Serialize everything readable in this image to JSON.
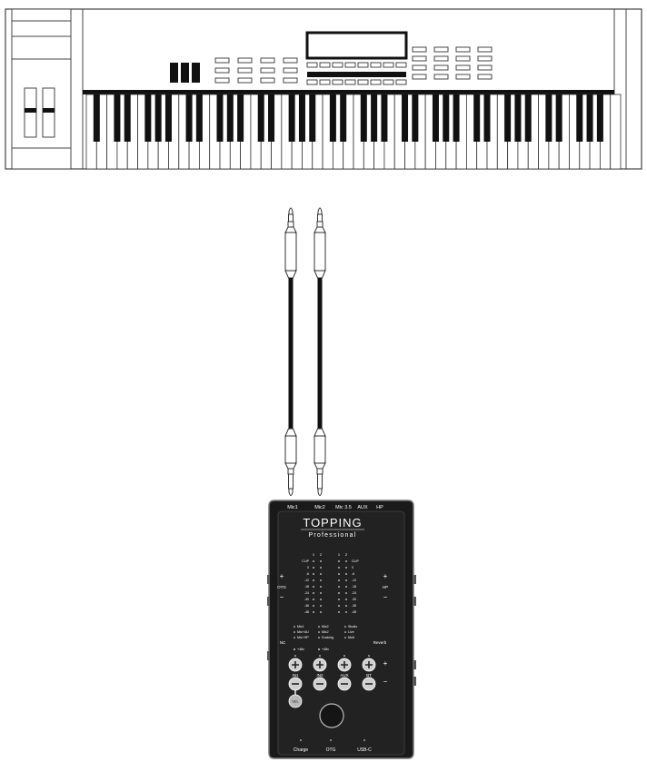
{
  "device": {
    "brand": "TOPPING",
    "subtitle": "Professional",
    "top_inputs": [
      "Mic1",
      "Mic2",
      "Mic 3.5",
      "AUX",
      "HP"
    ],
    "side_left_otg": "OTG",
    "side_right_hp": "HP",
    "side_left_nc": "NC",
    "side_right_reverb": "Reverb",
    "plus": "+",
    "minus": "−",
    "meter_ch_left": [
      "1",
      "2"
    ],
    "meter_ch_right": [
      "1",
      "2"
    ],
    "meter_scale_left": [
      "CLIP",
      "0",
      "-6",
      "-12",
      "-18",
      "-24",
      "-30",
      "-36",
      "-48"
    ],
    "meter_scale_right": [
      "CLIP",
      "0",
      "-6",
      "-12",
      "-18",
      "-24",
      "-30",
      "-36",
      "-48"
    ],
    "mode_col1": [
      "Mic1",
      "Mic+AU",
      "Mic+HP"
    ],
    "mode_col2": [
      "Mic2",
      "Mic2",
      "Ducking"
    ],
    "mode_col3": [
      "Studio",
      "Live",
      "Mult"
    ],
    "phantom": [
      "+48v",
      "+48v"
    ],
    "knob_labels": [
      "IN1",
      "IN2",
      "AUX",
      "BT"
    ],
    "sel_label": "SEL",
    "bottom_ports": [
      "Charge",
      "OTG",
      "USB-C"
    ]
  }
}
